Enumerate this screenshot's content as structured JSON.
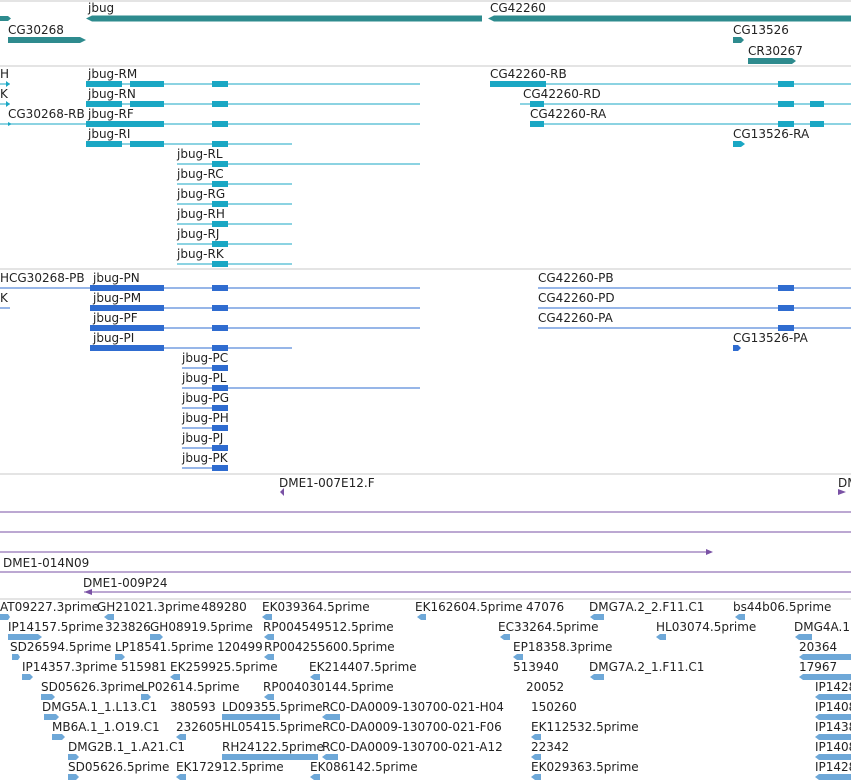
{
  "colors": {
    "gene": "#2e8b8e",
    "mrna": "#1aa7c4",
    "cds": "#2f6cd0",
    "clone": "#7a52a5",
    "est": "#6ea8d8",
    "divider": "#c8c8c8"
  },
  "track_genes": {
    "items": [
      {
        "label": "jbug"
      },
      {
        "label": "CG42260"
      },
      {
        "label": "CG30268"
      },
      {
        "label": "CG13526"
      },
      {
        "label": "CR30267"
      }
    ]
  },
  "track_transcripts": {
    "items": [
      {
        "label": "H"
      },
      {
        "label": "K"
      },
      {
        "label": "CG30268-RB"
      },
      {
        "label": "jbug-RM"
      },
      {
        "label": "jbug-RN"
      },
      {
        "label": "jbug-RF"
      },
      {
        "label": "jbug-RI"
      },
      {
        "label": "jbug-RL"
      },
      {
        "label": "jbug-RC"
      },
      {
        "label": "jbug-RG"
      },
      {
        "label": "jbug-RH"
      },
      {
        "label": "jbug-RJ"
      },
      {
        "label": "jbug-RK"
      },
      {
        "label": "CG42260-RB"
      },
      {
        "label": "CG42260-RD"
      },
      {
        "label": "CG42260-RA"
      },
      {
        "label": "CG13526-RA"
      }
    ]
  },
  "track_proteins": {
    "items": [
      {
        "label": "H"
      },
      {
        "label": "K"
      },
      {
        "label": "CG30268-PB"
      },
      {
        "label": "jbug-PN"
      },
      {
        "label": "jbug-PM"
      },
      {
        "label": "jbug-PF"
      },
      {
        "label": "jbug-PI"
      },
      {
        "label": "jbug-PC"
      },
      {
        "label": "jbug-PL"
      },
      {
        "label": "jbug-PG"
      },
      {
        "label": "jbug-PH"
      },
      {
        "label": "jbug-PJ"
      },
      {
        "label": "jbug-PK"
      },
      {
        "label": "CG42260-PB"
      },
      {
        "label": "CG42260-PD"
      },
      {
        "label": "CG42260-PA"
      },
      {
        "label": "CG13526-PA"
      }
    ]
  },
  "track_clones": {
    "items": [
      {
        "label": "DME1-007E12.F"
      },
      {
        "label": "DM"
      },
      {
        "label": "DME1-014N09"
      },
      {
        "label": "DME1-009P24"
      }
    ]
  },
  "track_ests": {
    "items": [
      {
        "label": "AT09227.3prime"
      },
      {
        "label": "GH21021.3prime"
      },
      {
        "label": "489280"
      },
      {
        "label": "EK039364.5prime"
      },
      {
        "label": "EK162604.5prime"
      },
      {
        "label": "47076"
      },
      {
        "label": "DMG7A.2_2.F11.C1"
      },
      {
        "label": "bs44b06.5prime"
      },
      {
        "label": "IP14157.5prime"
      },
      {
        "label": "323826"
      },
      {
        "label": "GH08919.5prime"
      },
      {
        "label": "RP004549512.5prime"
      },
      {
        "label": "EC33264.5prime"
      },
      {
        "label": "HL03074.5prime"
      },
      {
        "label": "DMG4A.1"
      },
      {
        "label": "SD26594.5prime"
      },
      {
        "label": "LP18541.5prime"
      },
      {
        "label": "120499"
      },
      {
        "label": "RP004255600.5prime"
      },
      {
        "label": "EP18358.3prime"
      },
      {
        "label": "20364"
      },
      {
        "label": "IP14357.3prime"
      },
      {
        "label": "515981"
      },
      {
        "label": "EK259925.5prime"
      },
      {
        "label": "EK214407.5prime"
      },
      {
        "label": "513940"
      },
      {
        "label": "DMG7A.2_1.F11.C1"
      },
      {
        "label": "17967"
      },
      {
        "label": "SD05626.3prime"
      },
      {
        "label": "LP02614.5prime"
      },
      {
        "label": "RP004030144.5prime"
      },
      {
        "label": "20052"
      },
      {
        "label": "IP1428"
      },
      {
        "label": "DMG5A.1_1.L13.C1"
      },
      {
        "label": "380593"
      },
      {
        "label": "LD09355.5prime"
      },
      {
        "label": "RC0-DA0009-130700-021-H04"
      },
      {
        "label": "150260"
      },
      {
        "label": "IP1408"
      },
      {
        "label": "MB6A.1_1.O19.C1"
      },
      {
        "label": "232605"
      },
      {
        "label": "HL05415.5prime"
      },
      {
        "label": "RC0-DA0009-130700-021-F06"
      },
      {
        "label": "EK112532.5prime"
      },
      {
        "label": "IP1438"
      },
      {
        "label": "DMG2B.1_1.A21.C1"
      },
      {
        "label": "RH24122.5prime"
      },
      {
        "label": "RC0-DA0009-130700-021-A12"
      },
      {
        "label": "22342"
      },
      {
        "label": "IP1408"
      },
      {
        "label": "SD05626.5prime"
      },
      {
        "label": "EK172912.5prime"
      },
      {
        "label": "EK086142.5prime"
      },
      {
        "label": "EK029363.5prime"
      },
      {
        "label": "IP1428"
      }
    ]
  }
}
